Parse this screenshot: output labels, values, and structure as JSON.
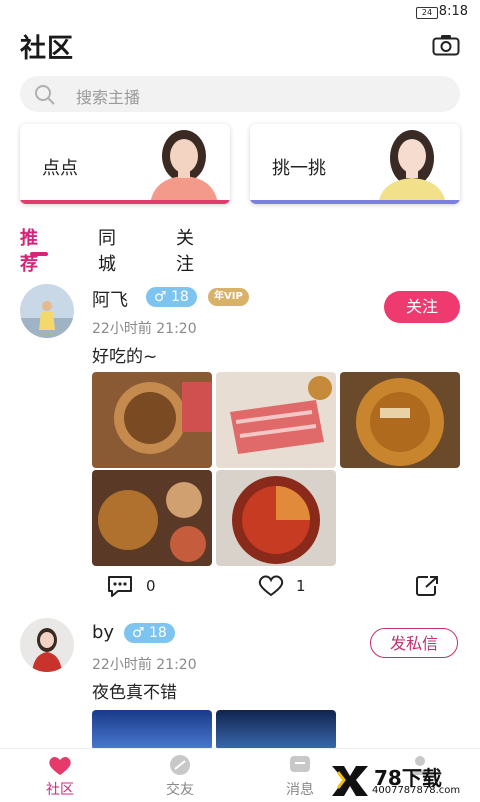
{
  "status_bar": {
    "battery": "24",
    "time": "8:18"
  },
  "header": {
    "title": "社区",
    "camera_icon": "camera-icon"
  },
  "search": {
    "placeholder": "搜索主播"
  },
  "cards": [
    {
      "label": "点点",
      "accent": "#e03c6e"
    },
    {
      "label": "挑一挑",
      "accent": "#7b7fe0"
    }
  ],
  "tabs": [
    {
      "label": "推荐",
      "active": true
    },
    {
      "label": "同城",
      "active": false
    },
    {
      "label": "关注",
      "active": false
    }
  ],
  "posts": [
    {
      "username": "阿飞",
      "gender_age": "♂ 18",
      "vip": "年VIP",
      "time": "22小时前 21:20",
      "text": "好吃的~",
      "follow_label": "关注",
      "comments": "0",
      "likes": "1"
    },
    {
      "username": "by",
      "gender_age": "♂ 18",
      "time": "22小时前 21:20",
      "text": "夜色真不错",
      "message_label": "发私信"
    }
  ],
  "bottom_nav": [
    {
      "label": "社区",
      "active": true
    },
    {
      "label": "交友",
      "active": false
    },
    {
      "label": "消息",
      "active": false
    }
  ],
  "watermark": {
    "brand": "78下载",
    "site": "4007787878.com"
  },
  "colors": {
    "accent": "#d6247a",
    "follow": "#ef3a6f",
    "badge": "#7ec4f0",
    "vip": "#d9b26a"
  }
}
